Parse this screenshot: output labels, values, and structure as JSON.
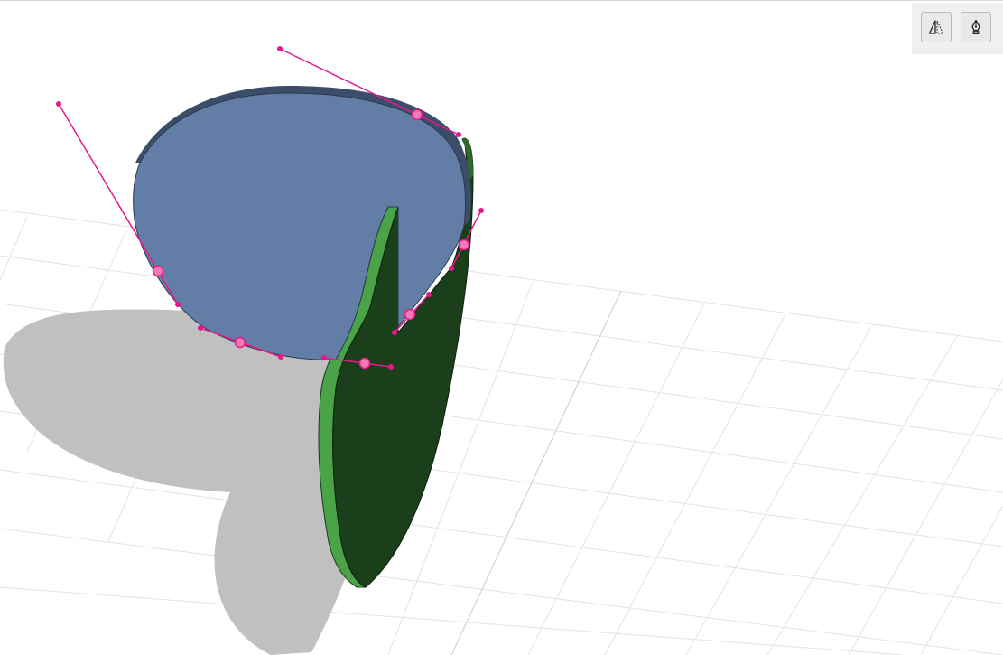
{
  "toolbar": {
    "buttons": [
      {
        "id": "mirror",
        "icon": "mirror-symmetry-icon"
      },
      {
        "id": "pen",
        "icon": "pen-tool-icon"
      }
    ]
  },
  "colors": {
    "background": "#ffffff",
    "grid": "#e3e3e3",
    "shadow": "#c0c0c0",
    "petal_face": "#637ea6",
    "petal_edge": "#3b4d68",
    "leaf_face": "#1b3f1b",
    "leaf_edge": "#4aa347",
    "curve_handles": "#e8178a",
    "control_point": "#f47ab6"
  }
}
